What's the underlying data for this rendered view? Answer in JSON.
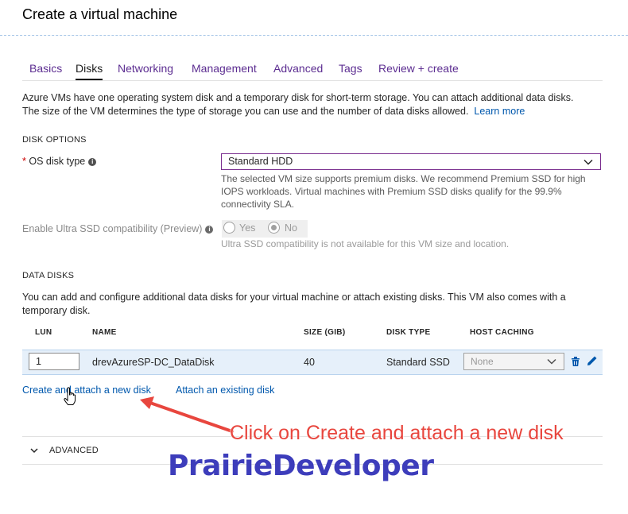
{
  "header": {
    "title": "Create a virtual machine"
  },
  "tabs": [
    {
      "label": "Basics"
    },
    {
      "label": "Disks"
    },
    {
      "label": "Networking"
    },
    {
      "label": "Management"
    },
    {
      "label": "Advanced"
    },
    {
      "label": "Tags"
    },
    {
      "label": "Review + create"
    }
  ],
  "active_tab": "Disks",
  "intro": {
    "line1": "Azure VMs have one operating system disk and a temporary disk for short-term storage. You can attach additional data disks.",
    "line2": "The size of the VM determines the type of storage you can use and the number of data disks allowed.",
    "learn_more": "Learn more"
  },
  "disk_options": {
    "heading": "DISK OPTIONS",
    "required_mark": "*",
    "os_disk_label": "OS disk type",
    "os_disk_value": "Standard HDD",
    "os_disk_hint": [
      "The selected VM size supports premium disks. We recommend Premium SSD for high",
      "IOPS workloads. Virtual machines with Premium SSD disks qualify for the 99.9%",
      "connectivity SLA."
    ],
    "ultra_label": "Enable Ultra SSD compatibility (Preview)",
    "ultra_yes": "Yes",
    "ultra_no": "No",
    "ultra_selected": "No",
    "ultra_hint": "Ultra SSD compatibility is not available for this VM size and location."
  },
  "data_disks": {
    "heading": "DATA DISKS",
    "desc_line1": "You can add and configure additional data disks for your virtual machine or attach existing disks. This VM also comes with a",
    "desc_line2": "temporary disk.",
    "columns": [
      "LUN",
      "NAME",
      "SIZE (GIB)",
      "DISK TYPE",
      "HOST CACHING"
    ],
    "rows": [
      {
        "lun": "1",
        "name": "drevAzureSP-DC_DataDisk",
        "size": "40",
        "type": "Standard SSD",
        "caching": "None"
      }
    ],
    "create_link": "Create and attach a new disk",
    "attach_link": "Attach an existing disk"
  },
  "advanced": {
    "label": "ADVANCED"
  },
  "annotation": {
    "text": "Click on Create and attach a new disk",
    "color": "#e8463e"
  },
  "watermark": {
    "text": "PrairieDeveloper",
    "color": "#3d3dbb"
  },
  "icons": {
    "info": "info-icon",
    "chevron": "chevron-down-icon",
    "delete": "trash-icon",
    "edit": "pencil-icon",
    "cursor": "hand-cursor-icon"
  },
  "colors": {
    "accent": "#5c2d91",
    "link": "#0058ad",
    "row_highlight": "#e6f0fa"
  }
}
